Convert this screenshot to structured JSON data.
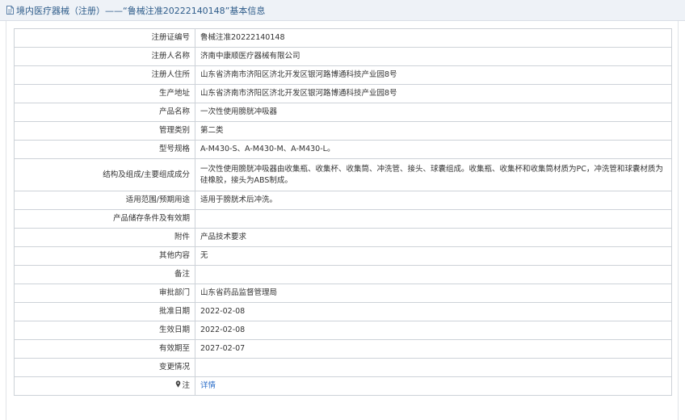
{
  "title": {
    "icon": "document-icon",
    "text": "境内医疗器械（注册）——“鲁械注准20222140148”基本信息"
  },
  "rows": [
    {
      "label": "注册证编号",
      "value": "鲁械注准20222140148"
    },
    {
      "label": "注册人名称",
      "value": "济南中康顺医疗器械有限公司"
    },
    {
      "label": "注册人住所",
      "value": "山东省济南市济阳区济北开发区银河路博通科技产业园8号"
    },
    {
      "label": "生产地址",
      "value": "山东省济南市济阳区济北开发区银河路博通科技产业园8号"
    },
    {
      "label": "产品名称",
      "value": "一次性使用膀胱冲吸器"
    },
    {
      "label": "管理类别",
      "value": "第二类"
    },
    {
      "label": "型号规格",
      "value": "A-M430-S、A-M430-M、A-M430-L。"
    },
    {
      "label": "结构及组成/主要组成成分",
      "value": "一次性使用膀胱冲吸器由收集瓶、收集杯、收集筒、冲洗管、接头、球囊组成。收集瓶、收集杯和收集筒材质为PC，冲洗管和球囊材质为硅橡胶，接头为ABS制成。"
    },
    {
      "label": "适用范围/预期用途",
      "value": "适用于膀胱术后冲洗。"
    },
    {
      "label": "产品储存条件及有效期",
      "value": ""
    },
    {
      "label": "附件",
      "value": "产品技术要求"
    },
    {
      "label": "其他内容",
      "value": "无"
    },
    {
      "label": "备注",
      "value": ""
    },
    {
      "label": "审批部门",
      "value": "山东省药品监督管理局"
    },
    {
      "label": "批准日期",
      "value": "2022-02-08"
    },
    {
      "label": "生效日期",
      "value": "2022-02-08"
    },
    {
      "label": "有效期至",
      "value": "2027-02-07"
    },
    {
      "label": "变更情况",
      "value": ""
    }
  ],
  "note_row": {
    "icon": "pin-icon",
    "label": "注",
    "link_text": "详情"
  },
  "colors": {
    "title_bg": "#eef2f7",
    "title_text": "#2e5c8a",
    "border": "#cdd2d8",
    "link": "#2a6cc8"
  }
}
